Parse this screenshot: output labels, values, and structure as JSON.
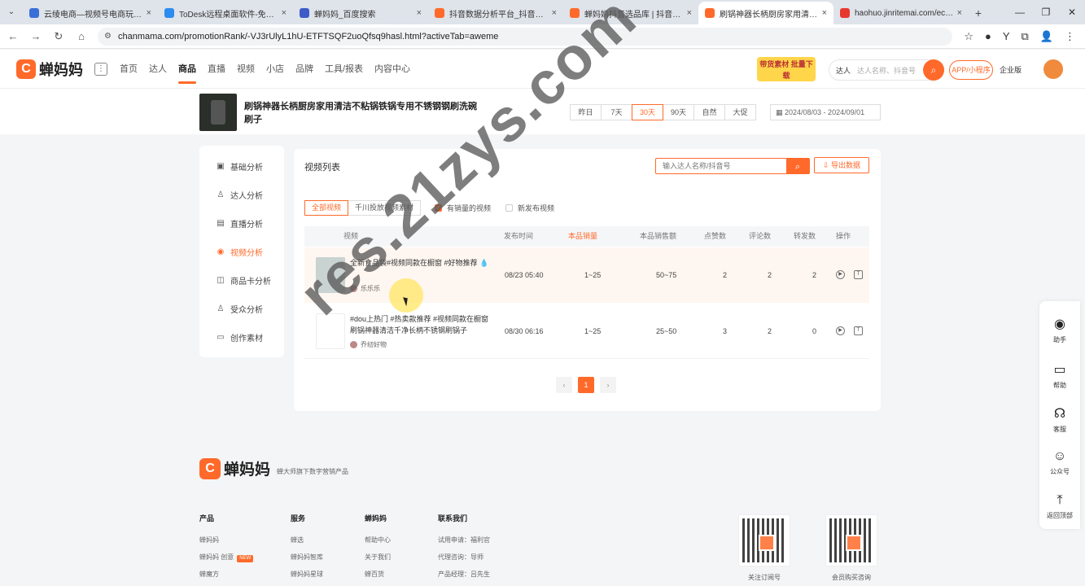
{
  "browser": {
    "tabs": [
      {
        "title": "云绫电商—视频号电商玩法全攻略",
        "color": "#3b6fd8"
      },
      {
        "title": "ToDesk远程桌面软件-免费安全",
        "color": "#2d8cf0"
      },
      {
        "title": "蝉妈妈_百度搜索",
        "color": "#3d5cc9"
      },
      {
        "title": "抖音数据分析平台_抖音直播数据",
        "color": "#ff6a2a"
      },
      {
        "title": "蝉妈妈抖音选品库 | 抖音短视频",
        "color": "#ff6a2a"
      },
      {
        "title": "刷锅神器长柄厨房家用清洁不粘锅",
        "color": "#ff6a2a"
      },
      {
        "title": "haohuo.jinritemai.com/ecom",
        "color": "#e8392f"
      }
    ],
    "active_tab_index": 5,
    "url": "chanmama.com/promotionRank/-VJ3rUlyL1hU-ETFTSQF2uoQfsq9hasl.html?activeTab=aweme"
  },
  "header": {
    "logo_text": "蝉妈妈",
    "nav": [
      "首页",
      "达人",
      "商品",
      "直播",
      "视频",
      "小店",
      "品牌",
      "工具/报表",
      "内容中心"
    ],
    "active_nav": "商品",
    "promo": "带货素材 批量下载",
    "search_scope": "达人",
    "search_placeholder": "达人名称、抖音号",
    "app_button": "APP/小程序",
    "enterprise_button": "企业版"
  },
  "product": {
    "title": "刷锅神器长柄厨房家用清洁不粘锅铁锅专用不锈钢钢刷洗碗刷子",
    "ranges": [
      "昨日",
      "7天",
      "30天",
      "90天",
      "自然",
      "大促"
    ],
    "active_range": "30天",
    "date_range": "2024/08/03 - 2024/09/01"
  },
  "sidebar": {
    "items": [
      {
        "label": "基础分析",
        "icon": "chart-icon"
      },
      {
        "label": "达人分析",
        "icon": "person-icon"
      },
      {
        "label": "直播分析",
        "icon": "tv-icon"
      },
      {
        "label": "视频分析",
        "icon": "play-icon"
      },
      {
        "label": "商品卡分析",
        "icon": "bag-icon"
      },
      {
        "label": "受众分析",
        "icon": "user-icon"
      },
      {
        "label": "创作素材",
        "icon": "folder-icon"
      }
    ],
    "active": "视频分析"
  },
  "video_panel": {
    "title": "视频列表",
    "search_placeholder": "输入达人名称/抖音号",
    "export_label": "导出数据",
    "filters": [
      "全部视频",
      "千川投放视频素材"
    ],
    "active_filter": "全部视频",
    "check_sales": "有销量的视频",
    "check_new": "新发布视频",
    "columns": [
      "视频",
      "发布时间",
      "本品销量",
      "本品销售额",
      "点赞数",
      "评论数",
      "转发数",
      "操作"
    ],
    "rows": [
      {
        "title": "全新食品袋#视频同款在橱窗 #好物推荐 💧",
        "author": "乐乐乐",
        "time": "08/23 05:40",
        "sales": "1~25",
        "revenue": "50~75",
        "likes": "2",
        "comments": "2",
        "shares": "2"
      },
      {
        "title": "#dou上热门 #热卖款推荐 #视频同款在橱窗 刷锅神器清洁千净长柄不锈钢刷锅子",
        "author": "乔纫好物",
        "time": "08/30 06:16",
        "sales": "1~25",
        "revenue": "25~50",
        "likes": "3",
        "comments": "2",
        "shares": "0"
      }
    ],
    "pagination": {
      "prev": "‹",
      "current": "1",
      "next": "›"
    }
  },
  "footer": {
    "logo_text": "蝉妈妈",
    "slogan": "蝉大师旗下数字营销产品",
    "columns": [
      {
        "head": "产品",
        "items": [
          "蝉妈妈",
          "蝉妈妈 创意",
          "蝉魔方"
        ]
      },
      {
        "head": "服务",
        "items": [
          "蝉选",
          "蝉妈妈智库",
          "蝉妈妈星球"
        ]
      },
      {
        "head": "蝉妈妈",
        "items": [
          "帮助中心",
          "关于我们",
          "蝉百货"
        ]
      },
      {
        "head": "联系我们",
        "items": [
          "试用申请：福利官",
          "代理咨询：导师",
          "产品经理：吕先生"
        ]
      }
    ],
    "new_badge": "NEW",
    "qr_captions": [
      "关注订阅号",
      "会员购买咨询"
    ]
  },
  "right_bar": {
    "items": [
      {
        "label": "助手",
        "icon": "bot-icon"
      },
      {
        "label": "帮助",
        "icon": "book-icon"
      },
      {
        "label": "客服",
        "icon": "headset-icon"
      },
      {
        "label": "公众号",
        "icon": "wechat-icon"
      },
      {
        "label": "返回顶部",
        "icon": "top-arrow-icon"
      }
    ]
  },
  "watermark": "res.21zys.com"
}
